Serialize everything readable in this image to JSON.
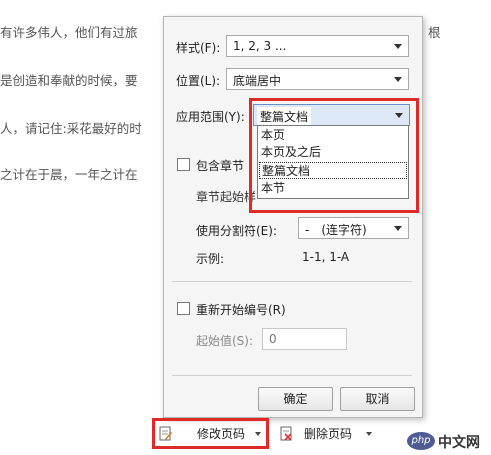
{
  "document": {
    "lines": [
      "有许多伟人，他们有过旅",
      "是创造和奉献的时候，要",
      "人，请记住:采花最好的时",
      "之计在于晨，一年之计在"
    ],
    "right_fragment": "根"
  },
  "dialog": {
    "style_label": "样式(F):",
    "style_value": "1, 2, 3 ...",
    "position_label": "位置(L):",
    "position_value": "底端居中",
    "scope_label": "应用范围(Y):",
    "scope_value": "整篇文档",
    "scope_options": [
      "本页",
      "本页及之后",
      "整篇文档",
      "本节"
    ],
    "scope_selected_index": 2,
    "include_chapter_label": "包含章节",
    "chapter_start_label": "章节起始样",
    "separator_label": "使用分割符(E):",
    "separator_value": "-　(连字符)",
    "example_label": "示例:",
    "example_value": "1-1, 1-A",
    "restart_label": "重新开始编号(R)",
    "start_value_label": "起始值(S):",
    "start_value": "0",
    "ok_label": "确定",
    "cancel_label": "取消"
  },
  "toolbar": {
    "modify_label": "修改页码",
    "delete_label": "删除页码"
  },
  "watermark": {
    "text": "中文网",
    "badge": "php"
  },
  "colors": {
    "highlight": "#e02a2a",
    "selection": "#dde8f7",
    "brand": "#4f5b93"
  }
}
